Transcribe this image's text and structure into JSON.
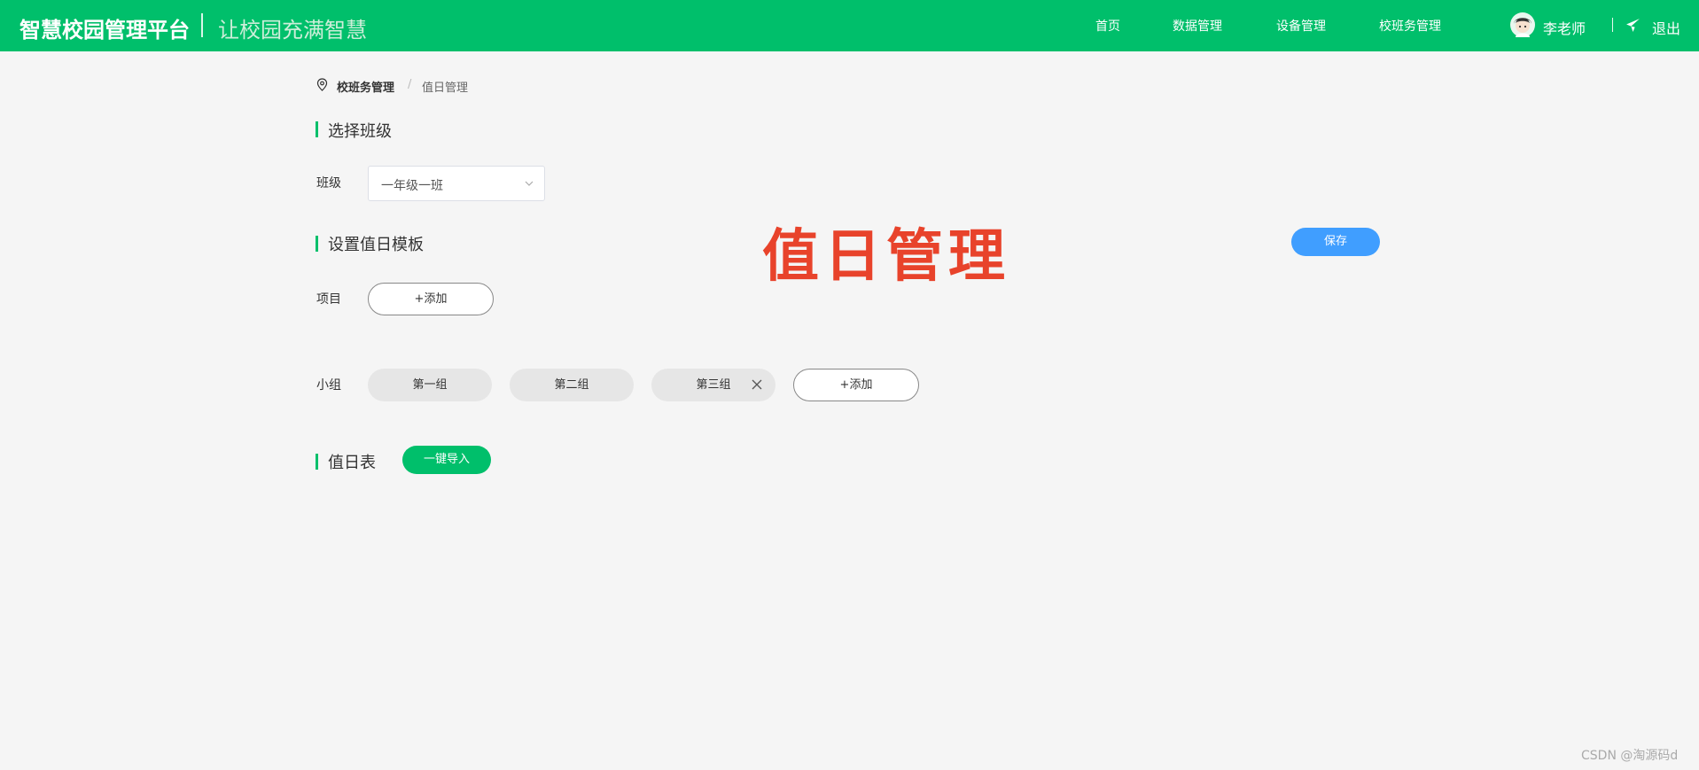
{
  "header": {
    "brand": "智慧校园管理平台",
    "slogan": "让校园充满智慧",
    "nav": [
      {
        "label": "首页"
      },
      {
        "label": "数据管理"
      },
      {
        "label": "设备管理"
      },
      {
        "label": "校班务管理"
      }
    ],
    "user_name": "李老师",
    "logout": "退出",
    "bg_color": "#00bf6b"
  },
  "breadcrumb": {
    "icon": "location-pin-icon",
    "items": [
      "校班务管理",
      "值日管理"
    ],
    "separator": "/"
  },
  "overlay_title": "值日管理",
  "sections": {
    "select_class": {
      "title": "选择班级",
      "label": "班级",
      "value": "一年级一班"
    },
    "template": {
      "title": "设置值日模板",
      "save_label": "保存",
      "items_label": "项目",
      "items_add": "+添加",
      "groups_label": "小组",
      "groups": [
        "第一组",
        "第二组",
        "第三组"
      ],
      "groups_add": "+添加"
    },
    "duty_table": {
      "title": "值日表",
      "import_label": "一键导入"
    }
  },
  "watermark": "CSDN @淘源码d",
  "colors": {
    "accent": "#00bf6b",
    "primary_button": "#409eff",
    "overlay_title": "#e8432b"
  }
}
